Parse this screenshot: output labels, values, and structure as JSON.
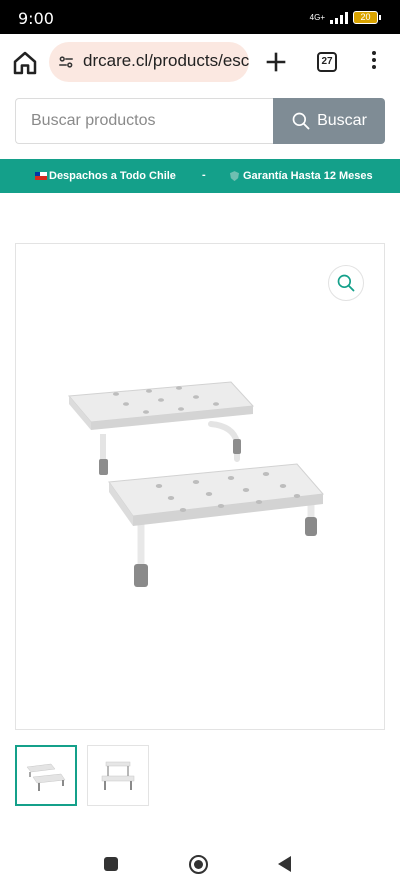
{
  "status_bar": {
    "time": "9:00",
    "network": "4G+",
    "battery": "20"
  },
  "browser": {
    "url": "drcare.cl/products/esc",
    "tab_count": "27",
    "icons": {
      "home": "home-icon",
      "site_settings": "tune-icon",
      "new_tab": "plus-icon",
      "tabs": "tabs-icon",
      "menu": "more-vert-icon"
    }
  },
  "search": {
    "placeholder": "Buscar productos",
    "button_label": "Buscar"
  },
  "promo": {
    "item_1": "Despachos a Todo Chile",
    "separator": "-",
    "item_2": "Garantía Hasta 12 Meses"
  },
  "product_gallery": {
    "main_image": "two-step-stool",
    "thumbnails": [
      {
        "image": "two-step-stool-angle",
        "active": true
      },
      {
        "image": "two-step-stool-front",
        "active": false
      }
    ]
  },
  "colors": {
    "accent": "#14a08a",
    "search_button": "#7f8c95",
    "url_pill": "#fbe8e1"
  }
}
